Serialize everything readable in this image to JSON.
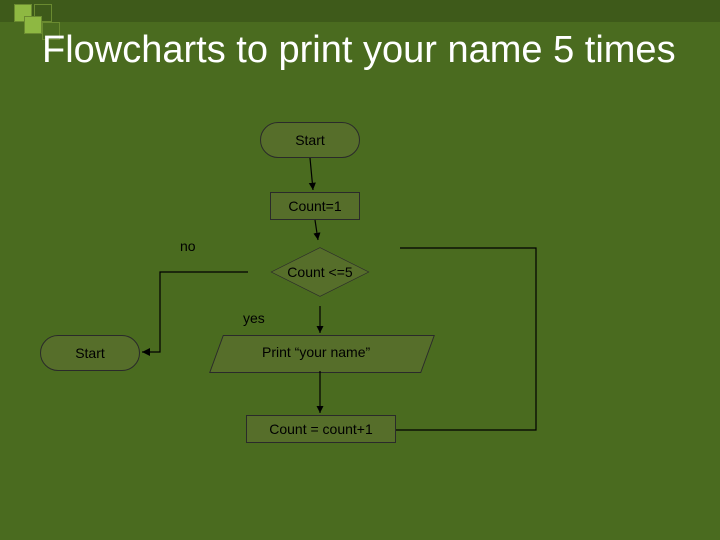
{
  "title": "Flowcharts to print your name 5 times",
  "start": "Start",
  "init": "Count=1",
  "decision": "Count <=5",
  "no": "no",
  "yes": "yes",
  "print": "Print “your name”",
  "increment": "Count = count+1",
  "end": "Start"
}
